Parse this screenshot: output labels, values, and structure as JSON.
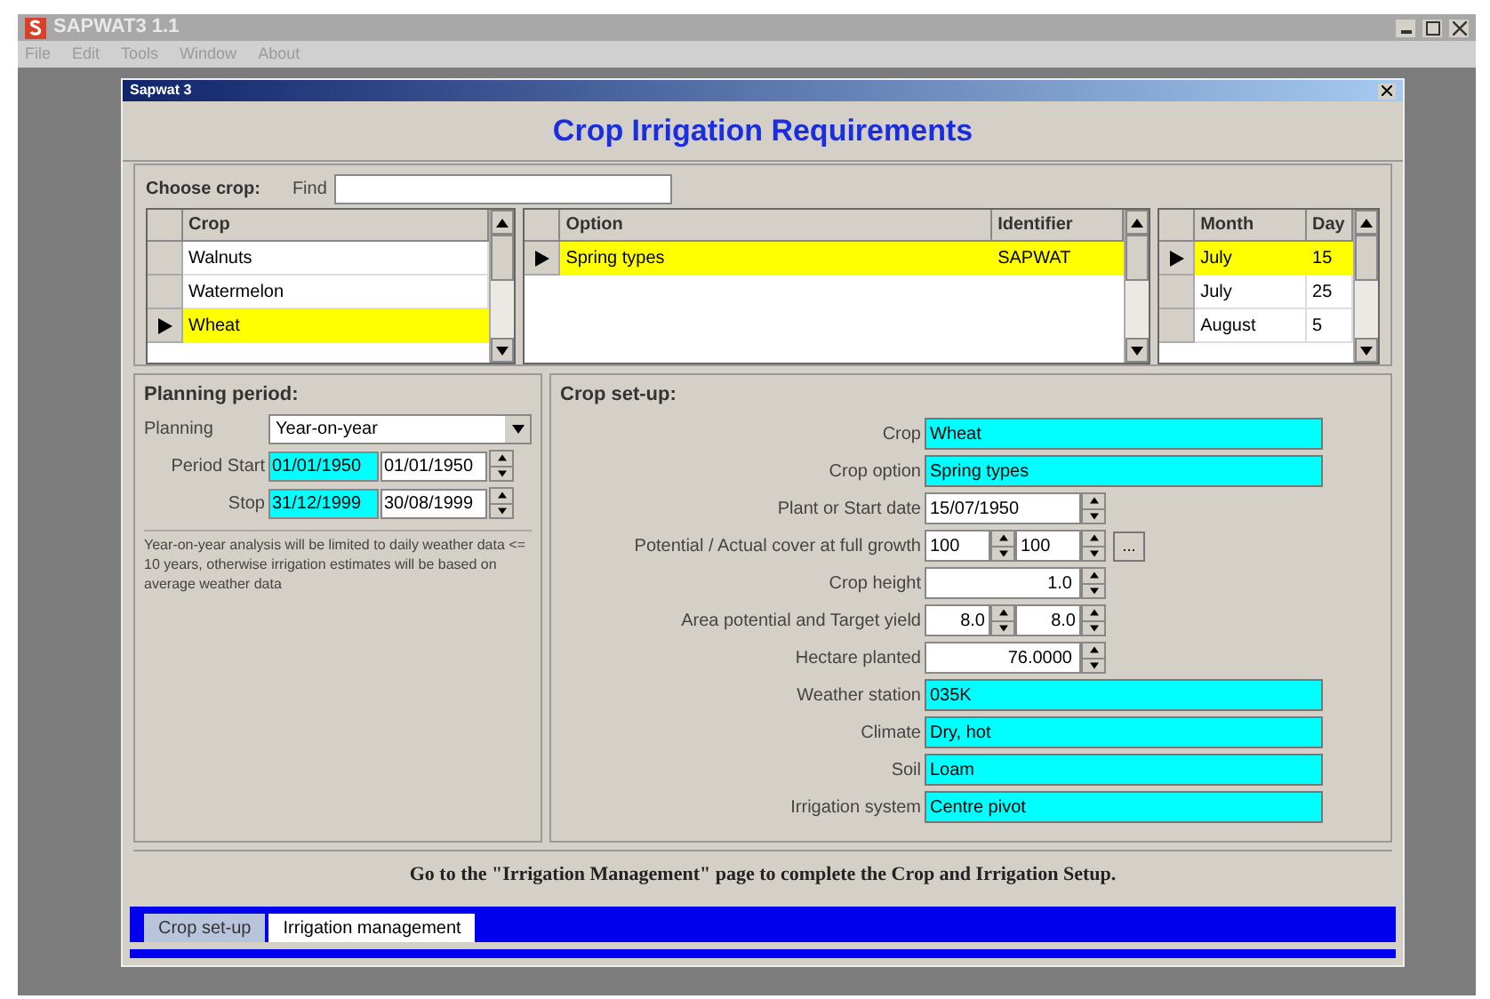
{
  "app": {
    "title": "SAPWAT3 1.1",
    "menu": [
      "File",
      "Edit",
      "Tools",
      "Window",
      "About"
    ]
  },
  "window": {
    "title": "Sapwat 3",
    "heading": "Crop Irrigation Requirements"
  },
  "choose_crop": {
    "label": "Choose crop:",
    "find_label": "Find",
    "crop_grid": {
      "columns": [
        "Crop"
      ],
      "rows": [
        {
          "cells": [
            "Walnuts"
          ],
          "selected": false
        },
        {
          "cells": [
            "Watermelon"
          ],
          "selected": false
        },
        {
          "cells": [
            "Wheat"
          ],
          "selected": true
        }
      ]
    },
    "option_grid": {
      "columns": [
        "Option",
        "Identifier"
      ],
      "rows": [
        {
          "cells": [
            "Spring types",
            "SAPWAT"
          ],
          "selected": true
        }
      ]
    },
    "date_grid": {
      "columns": [
        "Month",
        "Day"
      ],
      "rows": [
        {
          "cells": [
            "July",
            "15"
          ],
          "selected": true
        },
        {
          "cells": [
            "July",
            "25"
          ],
          "selected": false
        },
        {
          "cells": [
            "August",
            "5"
          ],
          "selected": false
        }
      ]
    }
  },
  "planning": {
    "title": "Planning period:",
    "planning_label": "Planning",
    "planning_value": "Year-on-year",
    "dates": [
      {
        "label": "Period Start",
        "limit": "01/01/1950",
        "value": "01/01/1950"
      },
      {
        "label": "Stop",
        "limit": "31/12/1999",
        "value": "30/08/1999"
      }
    ],
    "note": "Year-on-year analysis will be limited to daily weather data <= 10 years, otherwise irrigation estimates will be based on average weather data"
  },
  "crop_setup": {
    "title": "Crop set-up:",
    "rows": [
      {
        "kind": "readonly",
        "label": "Crop",
        "values": [
          "Wheat"
        ]
      },
      {
        "kind": "readonly",
        "label": "Crop option",
        "values": [
          "Spring types"
        ]
      },
      {
        "kind": "date",
        "label": "Plant or Start date",
        "values": [
          "15/07/1950"
        ]
      },
      {
        "kind": "pair",
        "label": "Potential / Actual cover at full growth",
        "values": [
          "100",
          "100"
        ],
        "button": "..."
      },
      {
        "kind": "number",
        "label": "Crop height",
        "values": [
          "1.0"
        ]
      },
      {
        "kind": "pair",
        "label": "Area potential and Target yield",
        "values": [
          "8.0",
          "8.0"
        ]
      },
      {
        "kind": "number",
        "label": "Hectare planted",
        "values": [
          "76.0000"
        ]
      },
      {
        "kind": "readonly",
        "label": "Weather station",
        "values": [
          "035K"
        ]
      },
      {
        "kind": "readonly",
        "label": "Climate",
        "values": [
          "Dry, hot"
        ]
      },
      {
        "kind": "readonly",
        "label": "Soil",
        "values": [
          "Loam"
        ]
      },
      {
        "kind": "readonly",
        "label": "Irrigation system",
        "values": [
          "Centre pivot"
        ]
      }
    ]
  },
  "footer_message": "Go to the \"Irrigation Management\" page to complete the Crop and Irrigation Setup.",
  "tabs": [
    {
      "label": "Crop set-up",
      "selected": true
    },
    {
      "label": "Irrigation management",
      "selected": false
    }
  ]
}
